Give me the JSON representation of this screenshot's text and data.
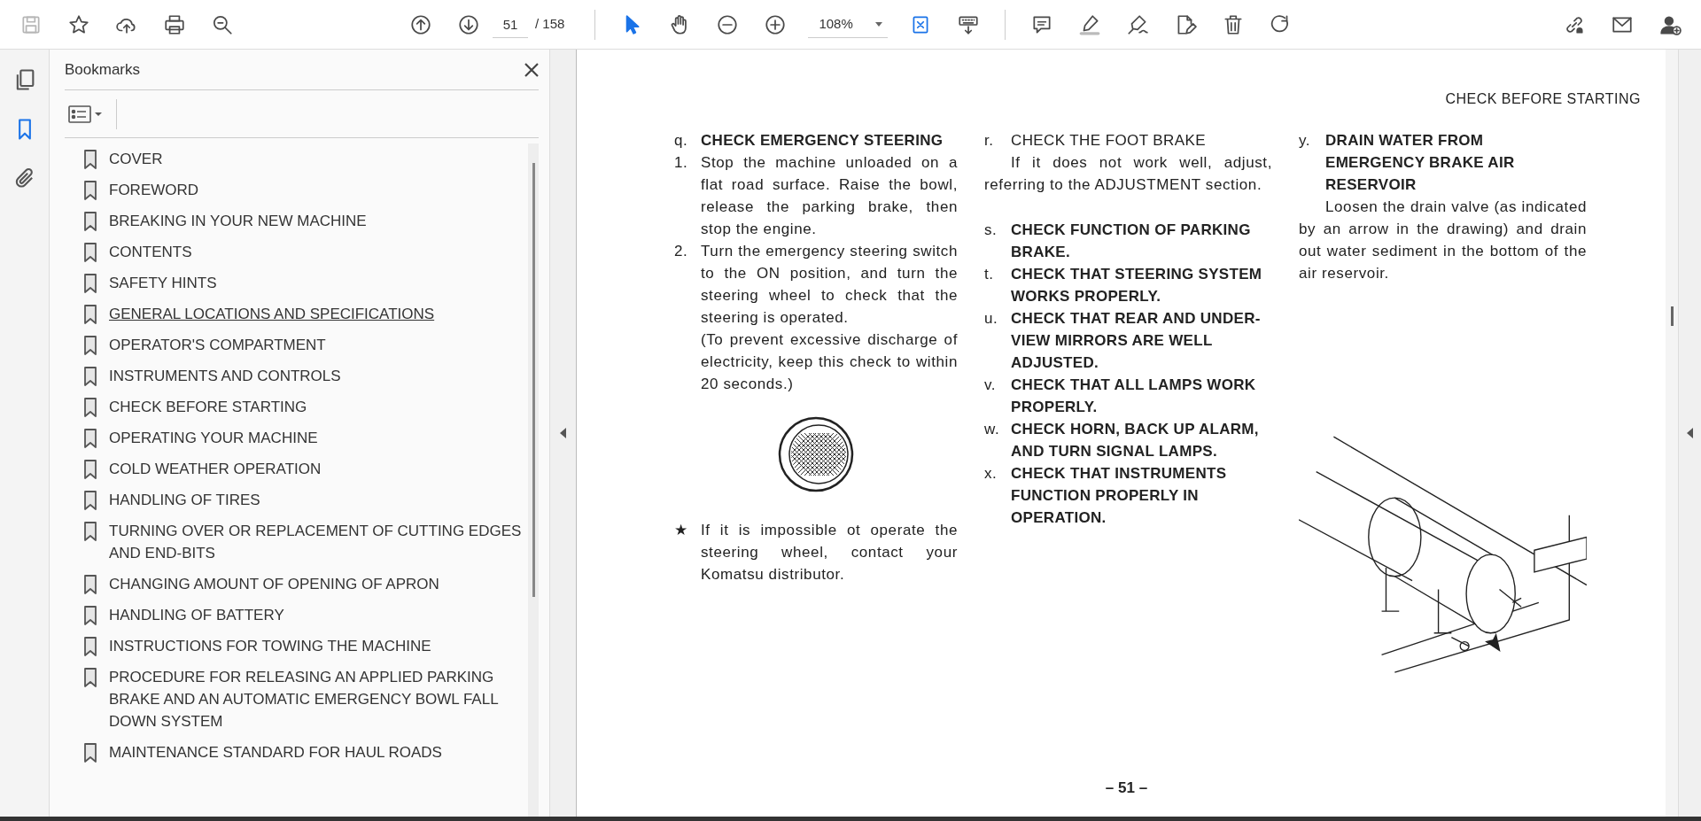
{
  "toolbar": {
    "left": [
      {
        "kind": "save",
        "disabled": true
      },
      {
        "kind": "star",
        "disabled": false
      },
      {
        "kind": "upload",
        "disabled": false
      },
      {
        "kind": "print",
        "disabled": false
      },
      {
        "kind": "find",
        "disabled": false
      }
    ],
    "center": [
      {
        "kind": "prev"
      },
      {
        "kind": "next"
      },
      {
        "kind": "page",
        "value": "51",
        "total": "/ 158"
      },
      {
        "kind": "divider"
      },
      {
        "kind": "select",
        "selected": true
      },
      {
        "kind": "hand",
        "selected": false
      },
      {
        "kind": "zoomout"
      },
      {
        "kind": "zoomin"
      },
      {
        "kind": "zoom",
        "value": "108%"
      },
      {
        "kind": "fit"
      },
      {
        "kind": "keyboard"
      },
      {
        "kind": "divider"
      },
      {
        "kind": "comment"
      },
      {
        "kind": "highlight"
      },
      {
        "kind": "sign"
      },
      {
        "kind": "edit"
      },
      {
        "kind": "delete"
      },
      {
        "kind": "redo"
      }
    ],
    "right": [
      {
        "kind": "link"
      },
      {
        "kind": "mail"
      },
      {
        "kind": "account"
      }
    ]
  },
  "rail": [
    {
      "kind": "pages",
      "selected": false
    },
    {
      "kind": "bookmarks",
      "selected": true
    },
    {
      "kind": "attachments",
      "selected": false
    }
  ],
  "bookmarks": {
    "title": "Bookmarks",
    "items": [
      {
        "label": "COVER",
        "underlined": false
      },
      {
        "label": "FOREWORD",
        "underlined": false
      },
      {
        "label": "BREAKING IN YOUR NEW MACHINE",
        "underlined": false
      },
      {
        "label": "CONTENTS",
        "underlined": false
      },
      {
        "label": "SAFETY HINTS",
        "underlined": false
      },
      {
        "label": "GENERAL LOCATIONS AND SPECIFICATIONS",
        "underlined": true
      },
      {
        "label": "OPERATOR'S COMPARTMENT",
        "underlined": false
      },
      {
        "label": "INSTRUMENTS AND CONTROLS",
        "underlined": false
      },
      {
        "label": "CHECK BEFORE STARTING",
        "underlined": false
      },
      {
        "label": "OPERATING YOUR MACHINE",
        "underlined": false
      },
      {
        "label": "COLD WEATHER OPERATION",
        "underlined": false
      },
      {
        "label": "HANDLING OF TIRES",
        "underlined": false
      },
      {
        "label": "TURNING OVER OR REPLACEMENT OF CUTTING EDGES AND END-BITS",
        "underlined": false
      },
      {
        "label": "CHANGING AMOUNT OF OPENING OF APRON",
        "underlined": false
      },
      {
        "label": "HANDLING OF BATTERY",
        "underlined": false
      },
      {
        "label": "INSTRUCTIONS FOR TOWING THE MACHINE",
        "underlined": false
      },
      {
        "label": "PROCEDURE FOR RELEASING AN APPLIED PARKING BRAKE AND AN AUTOMATIC EMERGENCY BOWL FALL DOWN SYSTEM",
        "underlined": false
      },
      {
        "label": "MAINTENANCE STANDARD FOR HAUL ROADS",
        "underlined": false
      }
    ]
  },
  "document": {
    "running_head": "CHECK BEFORE STARTING",
    "page_number": "– 51 –",
    "columns": [
      [
        {
          "kind": "heading",
          "mark": "q.",
          "text": "CHECK EMERGENCY STEERING"
        },
        {
          "kind": "step",
          "mark": "1.",
          "text": "Stop the machine unloaded on a flat road surface. Raise the bowl, release the parking brake, then stop the engine."
        },
        {
          "kind": "step",
          "mark": "2.",
          "text": "Turn the emergency steering switch to the ON position, and turn the steering wheel to check that the steering is operated."
        },
        {
          "kind": "para",
          "text": "(To prevent excessive discharge of electricity, keep this check to within 20 seconds.)"
        },
        {
          "kind": "grille"
        },
        {
          "kind": "note",
          "mark": "★",
          "text": "If it is impossible ot operate the steering wheel, contact your Komatsu distributor."
        }
      ],
      [
        {
          "kind": "subheading",
          "mark": "r.",
          "text": "CHECK THE FOOT BRAKE"
        },
        {
          "kind": "indent",
          "text": "If it does not work well, adjust, referring to the ADJUSTMENT section."
        },
        {
          "kind": "heading",
          "mark": "s.",
          "text": "CHECK FUNCTION OF PARKING BRAKE."
        },
        {
          "kind": "heading",
          "mark": "t.",
          "text": "CHECK THAT STEERING SYSTEM WORKS PROPERLY."
        },
        {
          "kind": "heading",
          "mark": "u.",
          "text": "CHECK THAT REAR AND UNDER-VIEW MIRRORS ARE WELL ADJUSTED."
        },
        {
          "kind": "heading",
          "mark": "v.",
          "text": "CHECK THAT ALL LAMPS WORK PROPERLY."
        },
        {
          "kind": "heading",
          "mark": "w.",
          "text": "CHECK HORN, BACK UP ALARM, AND TURN SIGNAL LAMPS."
        },
        {
          "kind": "heading",
          "mark": "x.",
          "text": "CHECK THAT INSTRUMENTS FUNCTION PROPERLY IN OPERATION."
        }
      ],
      [
        {
          "kind": "heading",
          "mark": "y.",
          "text": "DRAIN WATER FROM EMERGENCY BRAKE AIR RESERVOIR"
        },
        {
          "kind": "indent",
          "text": "Loosen the drain valve (as indicated by an arrow in the drawing) and drain out water sediment in the bottom of the air reservoir."
        },
        {
          "kind": "tank"
        }
      ]
    ]
  }
}
